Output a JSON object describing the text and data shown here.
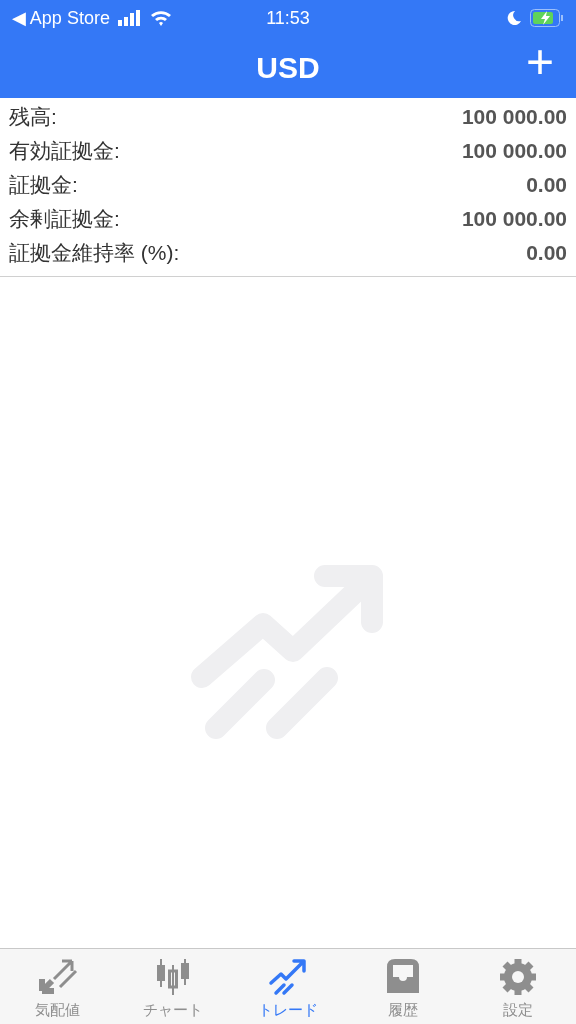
{
  "status_bar": {
    "back": "◀ App Store",
    "time": "11:53"
  },
  "header": {
    "title": "USD",
    "add": "+"
  },
  "summary": [
    {
      "label": "残高:",
      "value": "100 000.00"
    },
    {
      "label": "有効証拠金:",
      "value": "100 000.00"
    },
    {
      "label": "証拠金:",
      "value": "0.00"
    },
    {
      "label": "余剰証拠金:",
      "value": "100 000.00"
    },
    {
      "label": "証拠金維持率 (%):",
      "value": "0.00"
    }
  ],
  "tabs": [
    {
      "kind": "quotes",
      "label": "気配値",
      "selected": false
    },
    {
      "kind": "chart",
      "label": "チャート",
      "selected": false
    },
    {
      "kind": "trade",
      "label": "トレード",
      "selected": true
    },
    {
      "kind": "history",
      "label": "履歴",
      "selected": false
    },
    {
      "kind": "settings",
      "label": "設定",
      "selected": false
    }
  ]
}
